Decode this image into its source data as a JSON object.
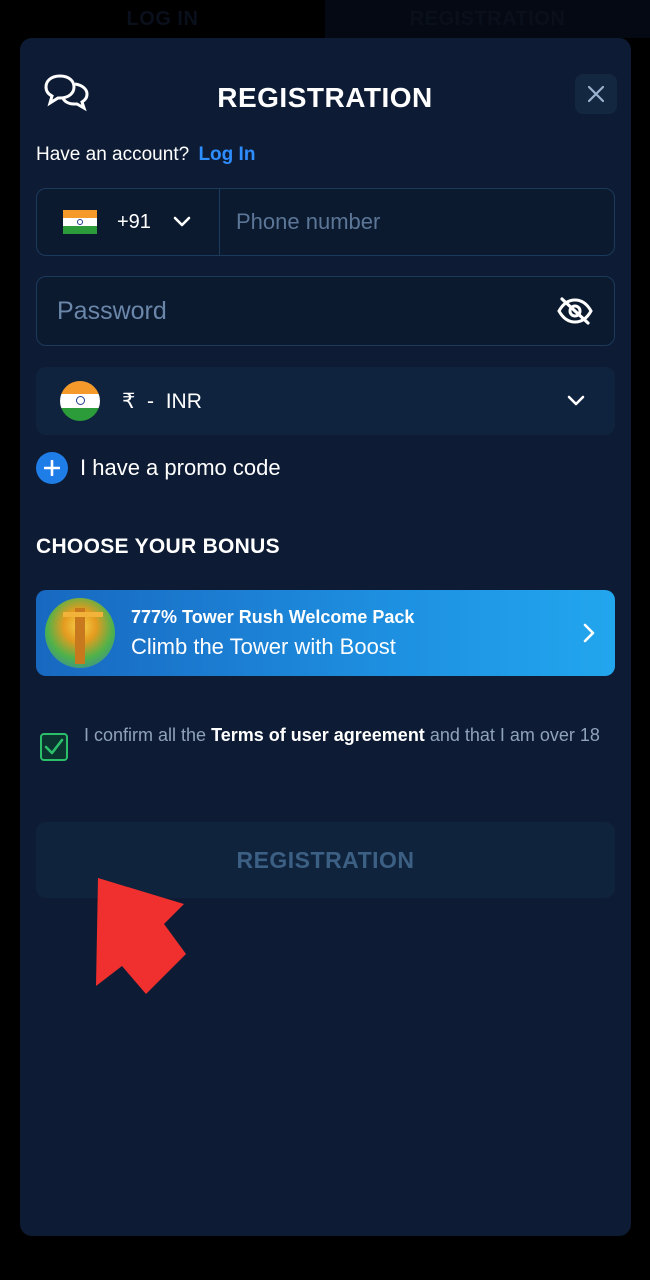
{
  "top_tabs": [
    "LOG IN",
    "REGISTRATION"
  ],
  "header": {
    "title": "REGISTRATION",
    "chat_icon": "chat-bubbles-icon",
    "close_icon": "close-icon"
  },
  "account": {
    "prompt": "Have an account?",
    "login_link": "Log In"
  },
  "phone": {
    "country_flag": "india-flag",
    "country_code": "+91",
    "placeholder": "Phone number"
  },
  "password": {
    "placeholder": "Password",
    "toggle_icon": "eye-slash-icon"
  },
  "currency": {
    "flag": "india-flag",
    "symbol": "₹",
    "separator": "-",
    "code": "INR"
  },
  "promo": {
    "label": "I have a promo code"
  },
  "bonus": {
    "heading": "CHOOSE YOUR BONUS",
    "title": "777% Tower Rush Welcome Pack",
    "subtitle": "Climb the Tower with Boost"
  },
  "terms": {
    "checked": true,
    "prefix": "I confirm all the",
    "link": "Terms of user agreement",
    "suffix": "and that I am over 18"
  },
  "submit": {
    "label": "REGISTRATION"
  },
  "colors": {
    "modal_bg": "#0d1c34",
    "accent_blue": "#2e8dff",
    "check_green": "#2bbf6a",
    "annotation_arrow": "#f0302e"
  }
}
